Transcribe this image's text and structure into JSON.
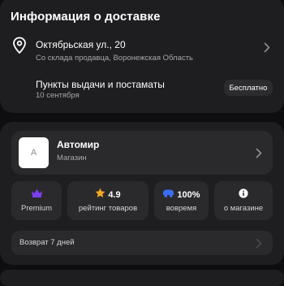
{
  "delivery": {
    "title": "Информация о доставке",
    "address": {
      "title": "Октябрьская ул., 20",
      "subtitle": "Со склада продавца, Воронежская Область"
    },
    "pickup": {
      "title": "Пункты выдачи и постаматы",
      "date": "10 сентября",
      "badge": "Бесплатно"
    }
  },
  "seller": {
    "avatar_letter": "A",
    "name": "Автомир",
    "type": "Магазин",
    "stats": [
      {
        "icon": "crown-icon",
        "value": "",
        "label": "Premium",
        "color": "#7b3ff2"
      },
      {
        "icon": "star-icon",
        "value": "4.9",
        "label": "рейтинг товаров",
        "color": "#f5a623"
      },
      {
        "icon": "truck-icon",
        "value": "100%",
        "label": "вовремя",
        "color": "#3b6cf6"
      },
      {
        "icon": "info-icon",
        "value": "",
        "label": "о магазине",
        "color": "#ffffff"
      }
    ],
    "return_policy": "Возврат 7 дней"
  }
}
